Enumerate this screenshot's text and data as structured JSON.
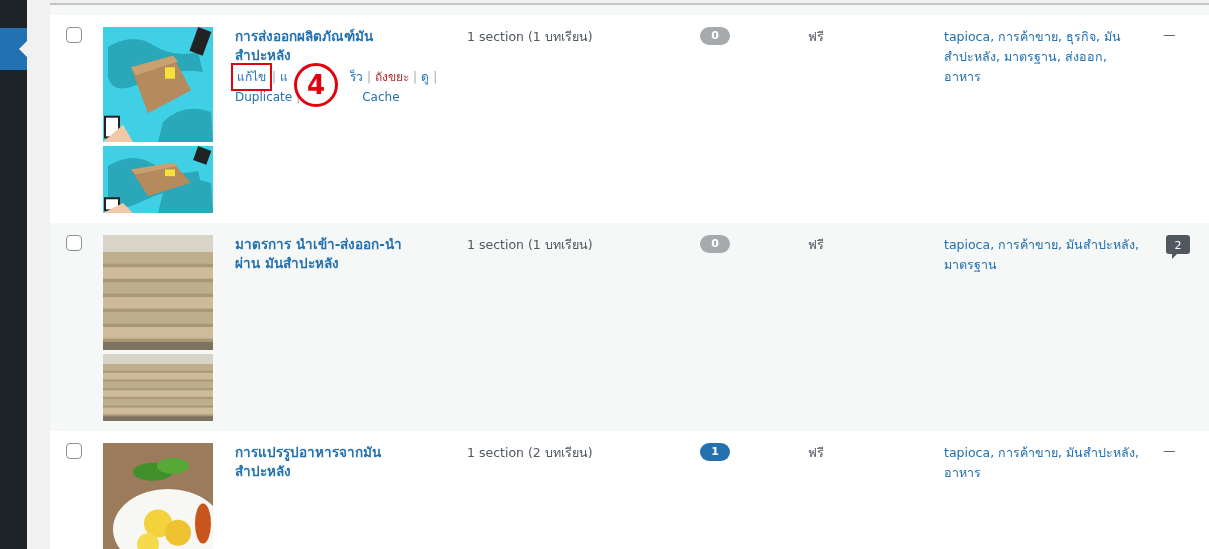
{
  "sidebar": {
    "items": [
      {
        "selected": true
      }
    ]
  },
  "rows": [
    {
      "checked": false,
      "thumbs": [
        {
          "kind": "picture"
        },
        {
          "kind": "picture"
        }
      ],
      "title": "การส่งออกผลิตภัณฑ์มันสำปะหลัง",
      "action_lines": [
        [
          {
            "kind": "link",
            "text": "แก้ไข",
            "highlighted": true
          },
          {
            "kind": "sep",
            "text": "|"
          },
          {
            "kind": "link",
            "text": "แ"
          },
          {
            "kind": "gap"
          },
          {
            "kind": "link",
            "text": "ร็ว"
          },
          {
            "kind": "sep",
            "text": "|"
          },
          {
            "kind": "trash",
            "text": "ถังขยะ"
          },
          {
            "kind": "sep",
            "text": "|"
          },
          {
            "kind": "link",
            "text": "ดู"
          },
          {
            "kind": "sep",
            "text": "|"
          }
        ],
        [
          {
            "kind": "link",
            "text": "Duplicate"
          },
          {
            "kind": "sep",
            "text": "|"
          },
          {
            "kind": "gap"
          },
          {
            "kind": "link",
            "text": "Cache"
          }
        ]
      ],
      "callout": "4",
      "sections": "1 section (1 บทเรียน)",
      "count": "0",
      "count_new": false,
      "price": "ฟรี",
      "tags": "tapioca, การค้าขาย, ธุรกิจ, มันสำปะหลัง, มาตรฐาน, ส่งออก, อาหาร",
      "comments": {
        "kind": "none",
        "text": "—"
      }
    },
    {
      "checked": false,
      "thumbs": [
        {
          "kind": "picture"
        },
        {
          "kind": "picture"
        }
      ],
      "title": "มาตรการ นำเข้า-ส่งออก-นำผ่าน มันสำปะหลัง",
      "action_lines": [],
      "sections": "1 section (1 บทเรียน)",
      "count": "0",
      "count_new": false,
      "price": "ฟรี",
      "tags": "tapioca, การค้าขาย, มันสำปะหลัง, มาตรฐาน",
      "comments": {
        "kind": "bubble",
        "text": "2"
      }
    },
    {
      "checked": false,
      "thumbs": [
        {
          "kind": "picture"
        }
      ],
      "title": "การแปรรูปอาหารจากมันสำปะหลัง",
      "action_lines": [],
      "sections": "1 section (2 บทเรียน)",
      "count": "1",
      "count_new": true,
      "price": "ฟรี",
      "tags": "tapioca, การค้าขาย, มันสำปะหลัง, อาหาร",
      "comments": {
        "kind": "none",
        "text": "—"
      }
    }
  ]
}
